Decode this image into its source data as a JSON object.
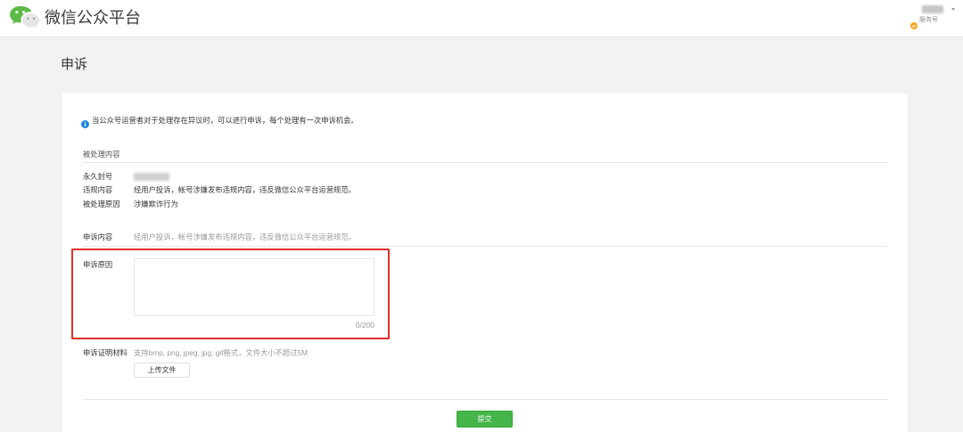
{
  "header": {
    "logo_icon": "wechat-logo-icon",
    "title": "微信公众平台",
    "account": {
      "avatar_icon": "avatar",
      "verified_icon": "verified-icon",
      "type_label": "服务号",
      "menu_icon": "chevron-down-icon"
    }
  },
  "page": {
    "title": "申诉"
  },
  "notice": {
    "icon": "info-icon",
    "text": "当公众号运营者对于处理存在异议时，可以进行申诉，每个处理有一次申诉机会。"
  },
  "processed": {
    "section_title": "被处理内容",
    "rows": [
      {
        "label": "永久封号"
      },
      {
        "label": "违规内容",
        "value": "经用户投诉，帐号涉嫌发布违规内容，违反微信公众平台运营规范。"
      },
      {
        "label": "被处理原因",
        "value": "涉嫌欺诈行为"
      }
    ]
  },
  "appeal": {
    "content_label": "申诉内容",
    "content_value": "经用户投诉，帐号涉嫌发布违规内容，违反微信公众平台运营规范。",
    "reason_label": "申诉原因",
    "reason_counter": "0/200",
    "evidence_label": "申诉证明材料",
    "evidence_hint": "支持bmp, png, jpeg, jpg, gif格式，文件大小不超过5M",
    "upload_label": "上传文件",
    "submit_label": "提交"
  },
  "colors": {
    "accent_green": "#44b549",
    "highlight_red": "#e0302a",
    "info_blue": "#1c86d8"
  }
}
